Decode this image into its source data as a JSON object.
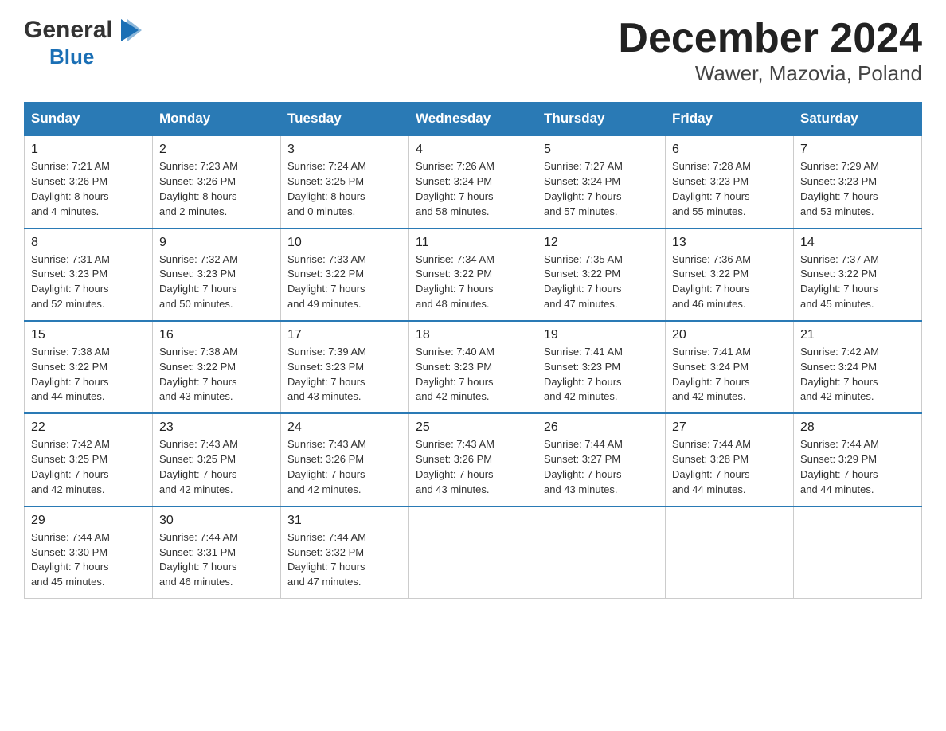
{
  "logo": {
    "general": "General",
    "blue": "Blue",
    "arrow_char": "▶"
  },
  "title": "December 2024",
  "subtitle": "Wawer, Mazovia, Poland",
  "days_of_week": [
    "Sunday",
    "Monday",
    "Tuesday",
    "Wednesday",
    "Thursday",
    "Friday",
    "Saturday"
  ],
  "weeks": [
    [
      {
        "day": "1",
        "info": "Sunrise: 7:21 AM\nSunset: 3:26 PM\nDaylight: 8 hours\nand 4 minutes."
      },
      {
        "day": "2",
        "info": "Sunrise: 7:23 AM\nSunset: 3:26 PM\nDaylight: 8 hours\nand 2 minutes."
      },
      {
        "day": "3",
        "info": "Sunrise: 7:24 AM\nSunset: 3:25 PM\nDaylight: 8 hours\nand 0 minutes."
      },
      {
        "day": "4",
        "info": "Sunrise: 7:26 AM\nSunset: 3:24 PM\nDaylight: 7 hours\nand 58 minutes."
      },
      {
        "day": "5",
        "info": "Sunrise: 7:27 AM\nSunset: 3:24 PM\nDaylight: 7 hours\nand 57 minutes."
      },
      {
        "day": "6",
        "info": "Sunrise: 7:28 AM\nSunset: 3:23 PM\nDaylight: 7 hours\nand 55 minutes."
      },
      {
        "day": "7",
        "info": "Sunrise: 7:29 AM\nSunset: 3:23 PM\nDaylight: 7 hours\nand 53 minutes."
      }
    ],
    [
      {
        "day": "8",
        "info": "Sunrise: 7:31 AM\nSunset: 3:23 PM\nDaylight: 7 hours\nand 52 minutes."
      },
      {
        "day": "9",
        "info": "Sunrise: 7:32 AM\nSunset: 3:23 PM\nDaylight: 7 hours\nand 50 minutes."
      },
      {
        "day": "10",
        "info": "Sunrise: 7:33 AM\nSunset: 3:22 PM\nDaylight: 7 hours\nand 49 minutes."
      },
      {
        "day": "11",
        "info": "Sunrise: 7:34 AM\nSunset: 3:22 PM\nDaylight: 7 hours\nand 48 minutes."
      },
      {
        "day": "12",
        "info": "Sunrise: 7:35 AM\nSunset: 3:22 PM\nDaylight: 7 hours\nand 47 minutes."
      },
      {
        "day": "13",
        "info": "Sunrise: 7:36 AM\nSunset: 3:22 PM\nDaylight: 7 hours\nand 46 minutes."
      },
      {
        "day": "14",
        "info": "Sunrise: 7:37 AM\nSunset: 3:22 PM\nDaylight: 7 hours\nand 45 minutes."
      }
    ],
    [
      {
        "day": "15",
        "info": "Sunrise: 7:38 AM\nSunset: 3:22 PM\nDaylight: 7 hours\nand 44 minutes."
      },
      {
        "day": "16",
        "info": "Sunrise: 7:38 AM\nSunset: 3:22 PM\nDaylight: 7 hours\nand 43 minutes."
      },
      {
        "day": "17",
        "info": "Sunrise: 7:39 AM\nSunset: 3:23 PM\nDaylight: 7 hours\nand 43 minutes."
      },
      {
        "day": "18",
        "info": "Sunrise: 7:40 AM\nSunset: 3:23 PM\nDaylight: 7 hours\nand 42 minutes."
      },
      {
        "day": "19",
        "info": "Sunrise: 7:41 AM\nSunset: 3:23 PM\nDaylight: 7 hours\nand 42 minutes."
      },
      {
        "day": "20",
        "info": "Sunrise: 7:41 AM\nSunset: 3:24 PM\nDaylight: 7 hours\nand 42 minutes."
      },
      {
        "day": "21",
        "info": "Sunrise: 7:42 AM\nSunset: 3:24 PM\nDaylight: 7 hours\nand 42 minutes."
      }
    ],
    [
      {
        "day": "22",
        "info": "Sunrise: 7:42 AM\nSunset: 3:25 PM\nDaylight: 7 hours\nand 42 minutes."
      },
      {
        "day": "23",
        "info": "Sunrise: 7:43 AM\nSunset: 3:25 PM\nDaylight: 7 hours\nand 42 minutes."
      },
      {
        "day": "24",
        "info": "Sunrise: 7:43 AM\nSunset: 3:26 PM\nDaylight: 7 hours\nand 42 minutes."
      },
      {
        "day": "25",
        "info": "Sunrise: 7:43 AM\nSunset: 3:26 PM\nDaylight: 7 hours\nand 43 minutes."
      },
      {
        "day": "26",
        "info": "Sunrise: 7:44 AM\nSunset: 3:27 PM\nDaylight: 7 hours\nand 43 minutes."
      },
      {
        "day": "27",
        "info": "Sunrise: 7:44 AM\nSunset: 3:28 PM\nDaylight: 7 hours\nand 44 minutes."
      },
      {
        "day": "28",
        "info": "Sunrise: 7:44 AM\nSunset: 3:29 PM\nDaylight: 7 hours\nand 44 minutes."
      }
    ],
    [
      {
        "day": "29",
        "info": "Sunrise: 7:44 AM\nSunset: 3:30 PM\nDaylight: 7 hours\nand 45 minutes."
      },
      {
        "day": "30",
        "info": "Sunrise: 7:44 AM\nSunset: 3:31 PM\nDaylight: 7 hours\nand 46 minutes."
      },
      {
        "day": "31",
        "info": "Sunrise: 7:44 AM\nSunset: 3:32 PM\nDaylight: 7 hours\nand 47 minutes."
      },
      {
        "day": "",
        "info": ""
      },
      {
        "day": "",
        "info": ""
      },
      {
        "day": "",
        "info": ""
      },
      {
        "day": "",
        "info": ""
      }
    ]
  ]
}
